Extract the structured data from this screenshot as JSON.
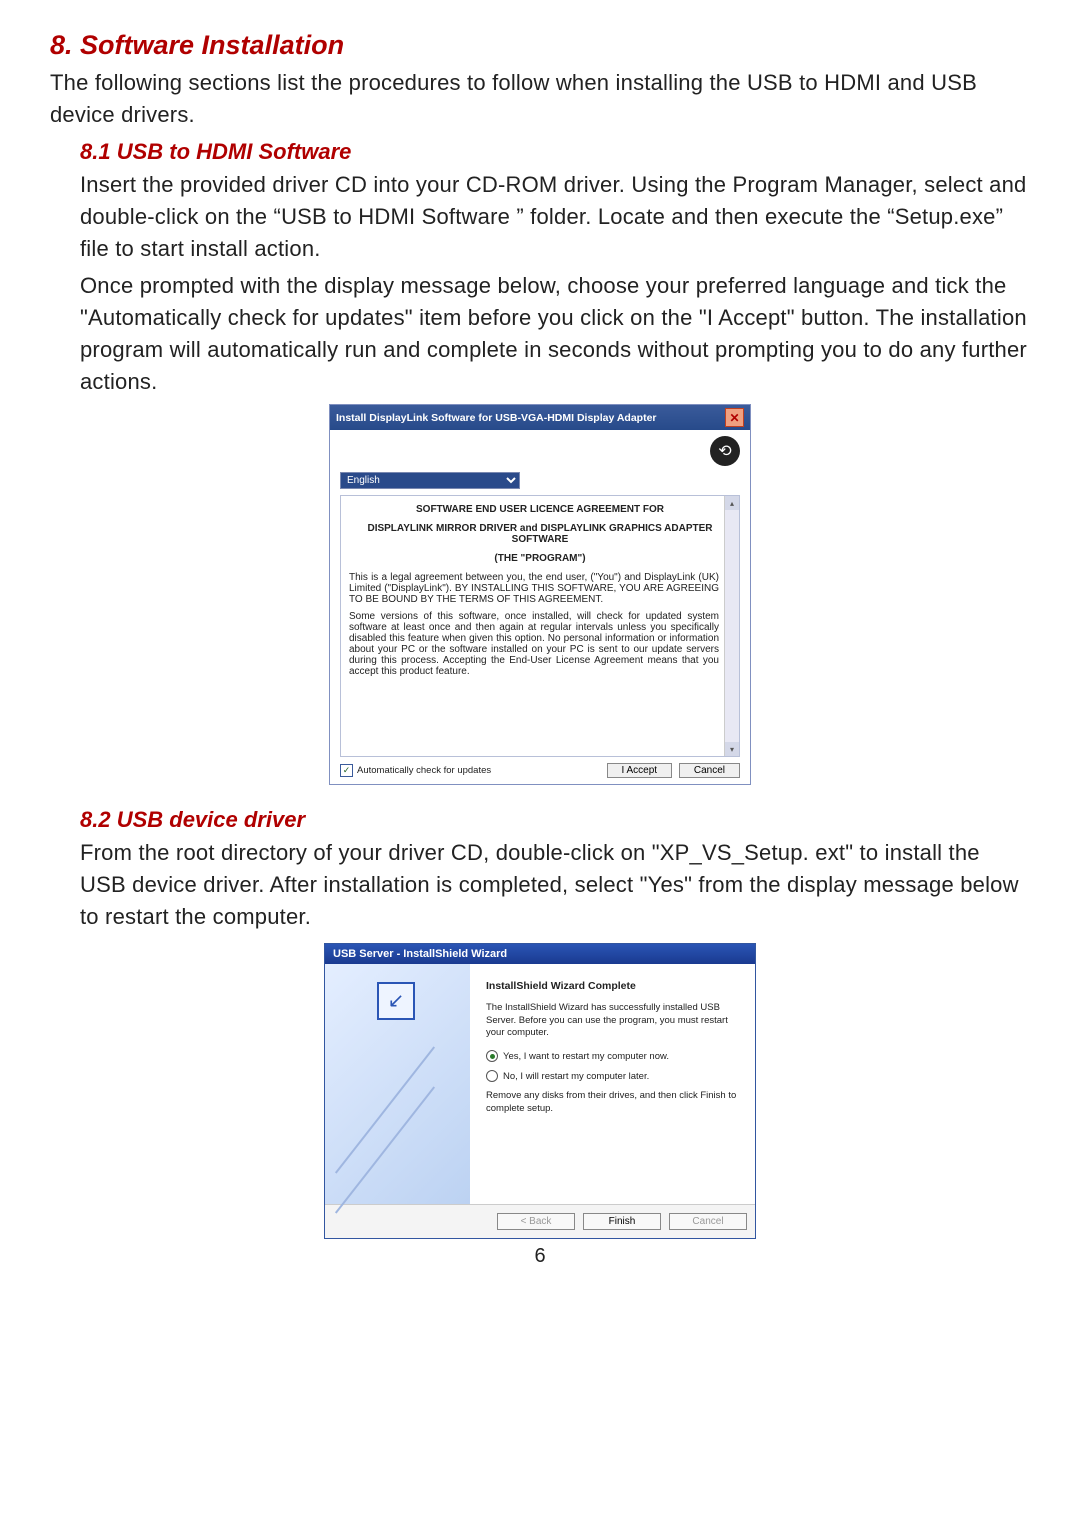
{
  "section": {
    "title": "8. Software Installation",
    "intro": "The following sections list the procedures to follow when installing the USB to HDMI and USB device drivers."
  },
  "sub81": {
    "title": "8.1 USB to HDMI Software",
    "p1": "Insert the provided driver CD into your CD-ROM driver. Using the Program Manager, select and double-click on the “USB to HDMI Software ” folder. Locate and then execute the “Setup.exe” file to start install action.",
    "p2": "Once prompted with the display message below, choose your preferred language and tick the \"Automatically check for updates\" item before you click on the \"I Accept\" button.  The installation program will automatically run and complete in seconds without prompting you to do any further actions."
  },
  "dialog1": {
    "title": "Install DisplayLink Software for USB-VGA-HDMI Display Adapter",
    "language_selected": "English",
    "eula_h1": "SOFTWARE END USER LICENCE AGREEMENT FOR",
    "eula_h2": "DISPLAYLINK MIRROR DRIVER and DISPLAYLINK GRAPHICS ADAPTER SOFTWARE",
    "eula_h3": "(THE \"PROGRAM\")",
    "eula_p1": "This is a legal agreement between you, the end user, (\"You\") and DisplayLink (UK) Limited (\"DisplayLink\"). BY INSTALLING THIS SOFTWARE, YOU ARE AGREEING TO BE BOUND BY THE TERMS OF THIS AGREEMENT.",
    "eula_p2": "Some versions of this software, once installed, will check for updated system software at least once and then again at regular intervals unless you specifically disabled this feature when given this option. No personal information or information about your PC or the software installed on your PC is sent to our update servers during this process. Accepting the End-User License Agreement means that you accept this product feature.",
    "checkbox_label": "Automatically check for updates",
    "btn_accept": "I Accept",
    "btn_cancel": "Cancel"
  },
  "sub82": {
    "title": "8.2 USB device driver",
    "p1": "From the root directory of your driver CD, double-click on \"XP_VS_Setup. ext\" to install the USB device driver.  After installation is completed, select \"Yes\" from the display message below to restart the computer."
  },
  "dialog2": {
    "title": "USB Server - InstallShield Wizard",
    "heading": "InstallShield Wizard Complete",
    "para1": "The InstallShield Wizard has successfully installed USB Server. Before you can use the program, you must restart your computer.",
    "radio_yes": "Yes, I want to restart my computer now.",
    "radio_no": "No, I will restart my computer later.",
    "para2": "Remove any disks from their drives, and then click Finish to complete setup.",
    "btn_back": "< Back",
    "btn_finish": "Finish",
    "btn_cancel": "Cancel"
  },
  "page_number": "6"
}
